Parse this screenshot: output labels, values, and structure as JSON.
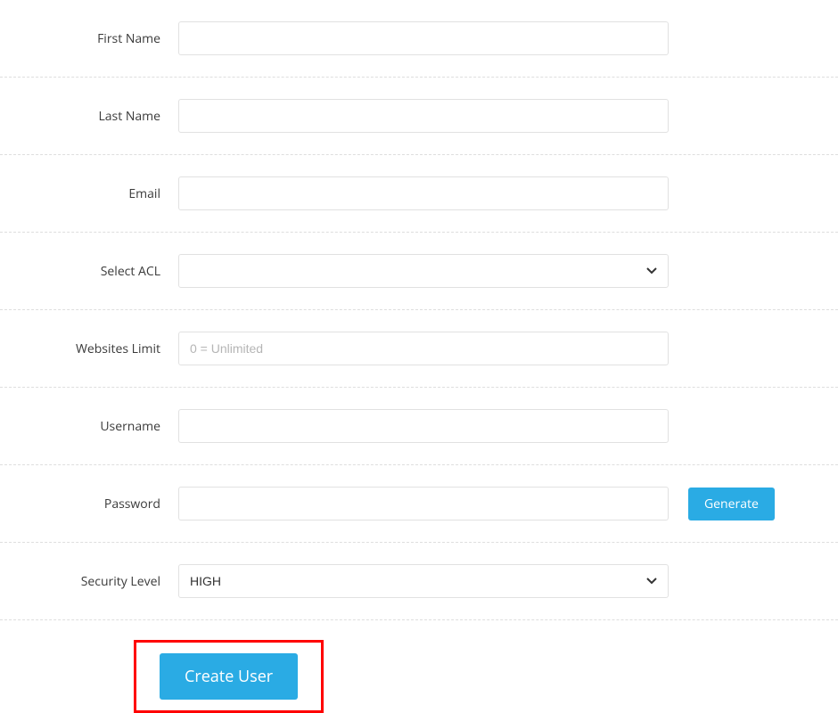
{
  "form": {
    "first_name": {
      "label": "First Name",
      "value": ""
    },
    "last_name": {
      "label": "Last Name",
      "value": ""
    },
    "email": {
      "label": "Email",
      "value": ""
    },
    "select_acl": {
      "label": "Select ACL",
      "value": ""
    },
    "websites_limit": {
      "label": "Websites Limit",
      "value": "",
      "placeholder": "0 = Unlimited"
    },
    "username": {
      "label": "Username",
      "value": ""
    },
    "password": {
      "label": "Password",
      "value": "",
      "generate_label": "Generate"
    },
    "security_level": {
      "label": "Security Level",
      "value": "HIGH"
    },
    "submit_label": "Create User"
  }
}
